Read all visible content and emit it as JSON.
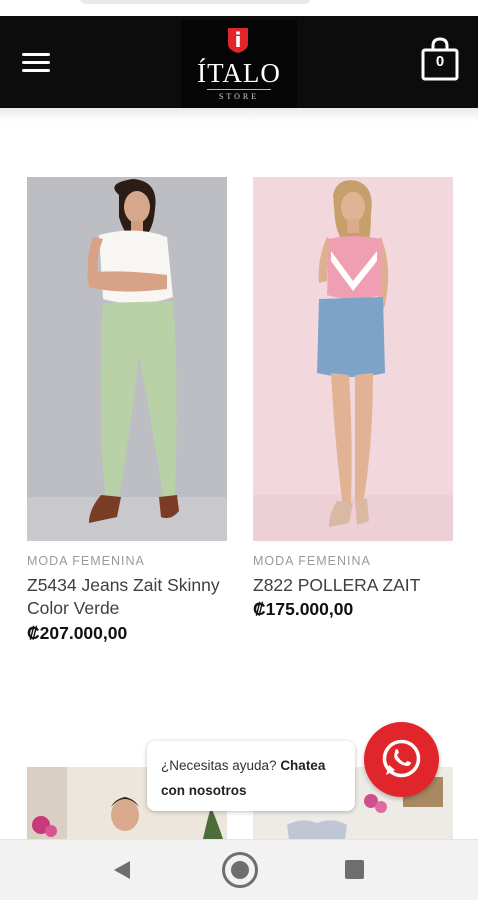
{
  "header": {
    "logo_text": "ÍTALO",
    "logo_sub": "STORE",
    "cart_count": "0",
    "icons": {
      "menu": "hamburger-menu-icon",
      "cart": "shopping-bag-icon"
    },
    "colors": {
      "bar": "#0c0c0c",
      "brand_red": "#e0262a"
    }
  },
  "products": [
    {
      "category": "MODA FEMENINA",
      "name": "Z5434 Jeans Zait Skinny Color Verde",
      "price": "₡207.000,00"
    },
    {
      "category": "MODA FEMENINA",
      "name": "Z822 POLLERA ZAIT",
      "price": "₡175.000,00"
    }
  ],
  "help": {
    "text": "¿Necesitas ayuda?",
    "cta": "Chatea con nosotros"
  },
  "whatsapp": {
    "icon": "whatsapp-icon",
    "color": "#e0262a"
  },
  "navbar": {
    "icons": [
      "back-triangle-icon",
      "home-circle-icon",
      "recent-apps-square-icon"
    ]
  }
}
